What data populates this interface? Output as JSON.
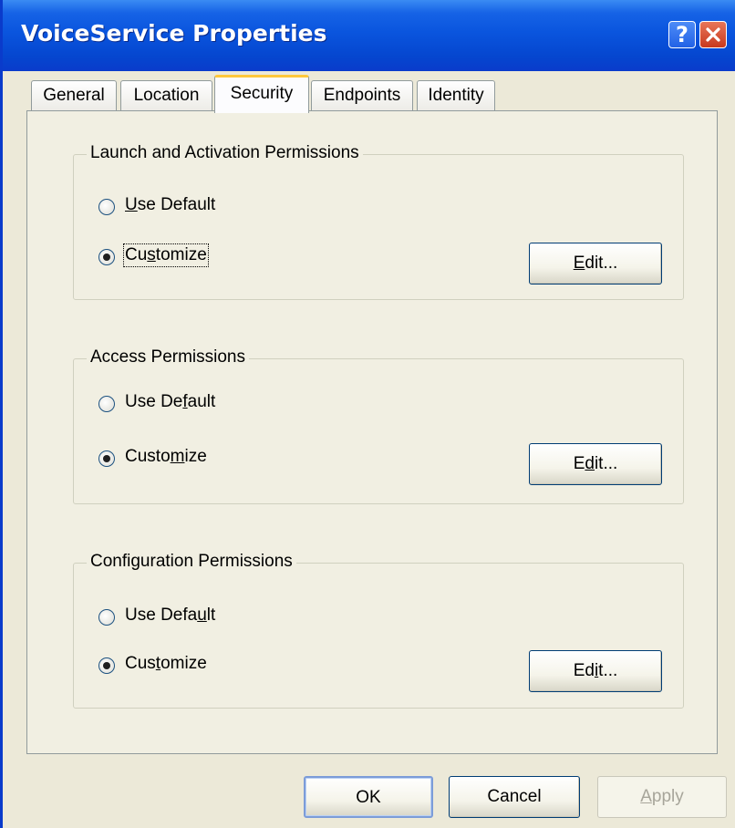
{
  "window": {
    "title": "VoiceService Properties",
    "help_symbol": "?",
    "colors": {
      "titlebar": "#0A55DE",
      "face": "#ECE9D8",
      "panel": "#F1EFE2",
      "active_tab_accent": "#FFC83C"
    }
  },
  "tabs": [
    {
      "label": "General"
    },
    {
      "label": "Location"
    },
    {
      "label": "Security",
      "active": true
    },
    {
      "label": "Endpoints"
    },
    {
      "label": "Identity"
    }
  ],
  "groups": [
    {
      "label": "Launch and Activation Permissions",
      "use_default": {
        "pre": "",
        "u": "U",
        "post": "se Default",
        "checked": false
      },
      "customize": {
        "pre": "Cu",
        "u": "s",
        "post": "tomize",
        "checked": true
      },
      "edit": {
        "pre": "",
        "u": "E",
        "post": "dit..."
      }
    },
    {
      "label": "Access Permissions",
      "use_default": {
        "pre": "Use De",
        "u": "f",
        "post": "ault",
        "checked": false
      },
      "customize": {
        "pre": "Custo",
        "u": "m",
        "post": "ize",
        "checked": true
      },
      "edit": {
        "pre": "E",
        "u": "d",
        "post": "it..."
      }
    },
    {
      "label": "Configuration Permissions",
      "use_default": {
        "pre": "Use Defa",
        "u": "u",
        "post": "lt",
        "checked": false
      },
      "customize": {
        "pre": "Cus",
        "u": "t",
        "post": "omize",
        "checked": true
      },
      "edit": {
        "pre": "Ed",
        "u": "i",
        "post": "t..."
      }
    }
  ],
  "buttons": {
    "ok": "OK",
    "cancel": "Cancel",
    "apply": {
      "u": "A",
      "post": "pply"
    }
  }
}
